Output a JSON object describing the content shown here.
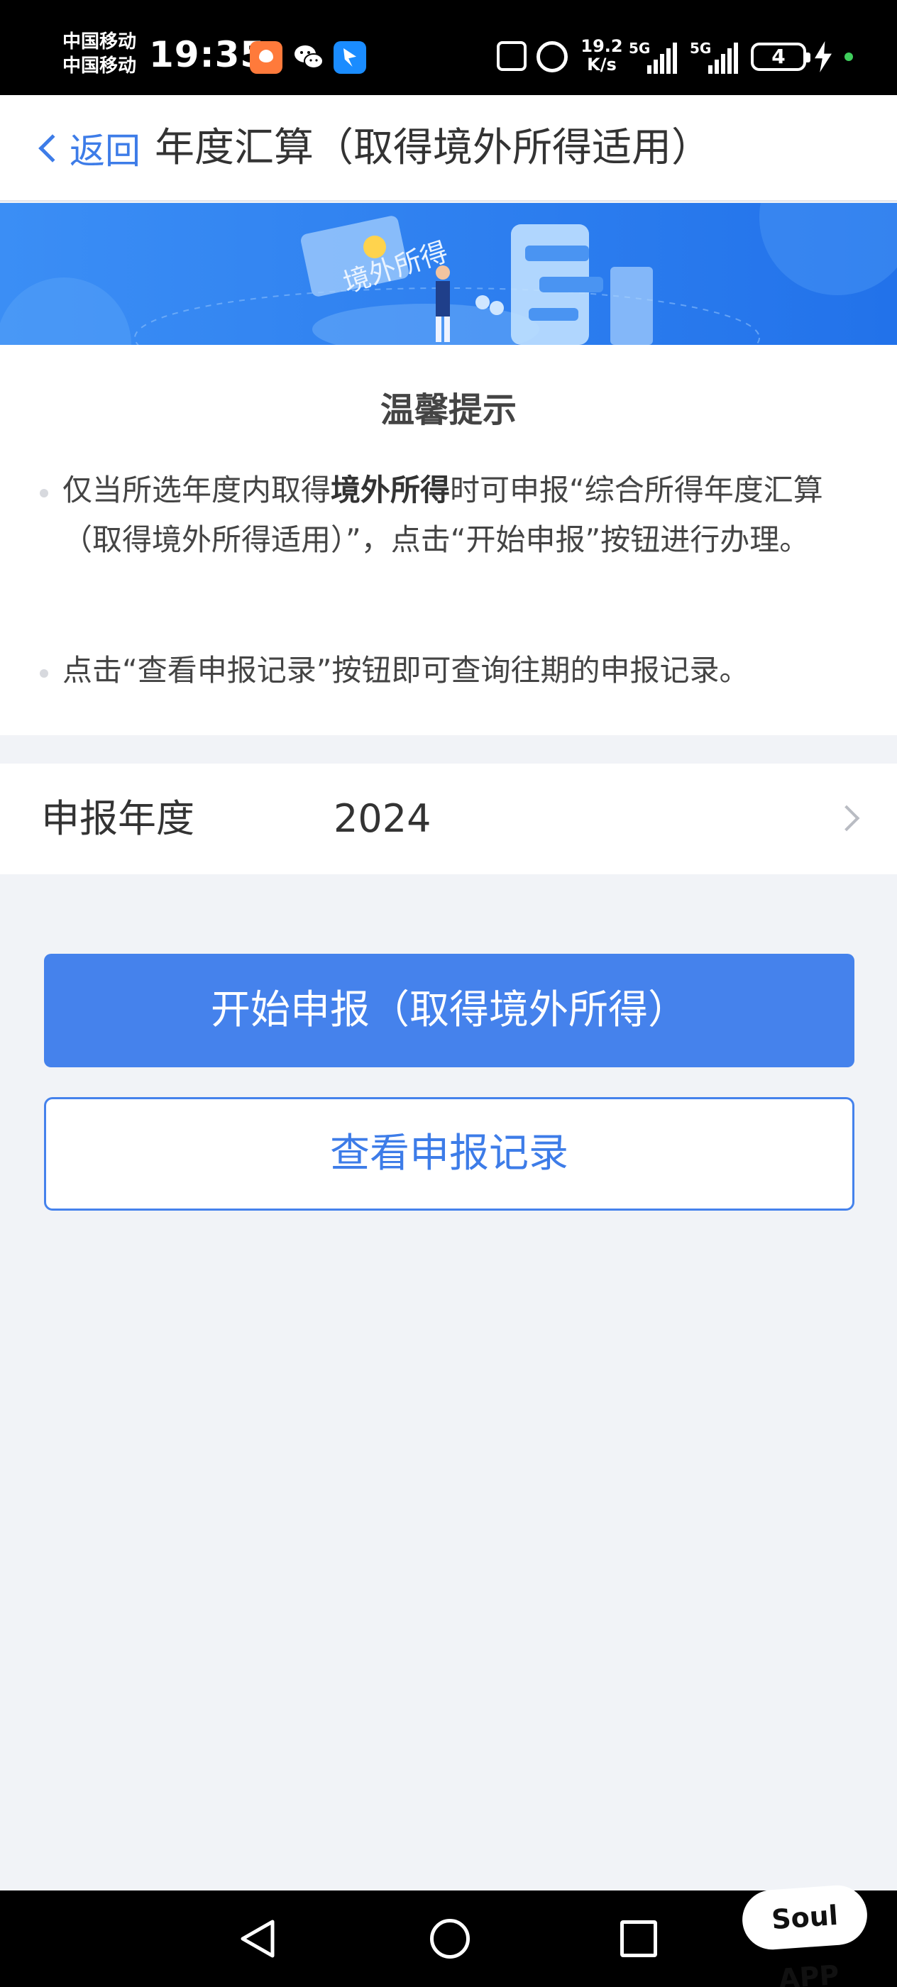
{
  "status_bar": {
    "carrier_1": "中国移动",
    "carrier_2": "中国移动",
    "time": "19:35",
    "net_speed_value": "19.2",
    "net_speed_unit": "K/s",
    "signal_1": "5G",
    "signal_2": "5G",
    "battery": "4",
    "icons": [
      "taobao-icon",
      "wechat-icon",
      "dingtalk-icon",
      "nfc-icon",
      "alarm-icon",
      "signal-icon",
      "battery-icon",
      "charging-icon"
    ]
  },
  "nav": {
    "back_label": "返回",
    "title": "年度汇算（取得境外所得适用）"
  },
  "banner": {
    "text": "境外所得",
    "colors": {
      "start": "#3a8df5",
      "end": "#1f6fe8"
    }
  },
  "notice": {
    "title": "温馨提示",
    "item_1_pre": "仅当所选年度内取得",
    "item_1_bold": "境外所得",
    "item_1_post": "时可申报“综合所得年度汇算（取得境外所得适用）”，点击“开始申报”按钮进行办理。",
    "item_2": "点击“查看申报记录”按钮即可查询往期的申报记录。"
  },
  "year_row": {
    "label": "申报年度",
    "value": "2024"
  },
  "buttons": {
    "start": "开始申报（取得境外所得）",
    "records": "查看申报记录"
  },
  "watermark": "Soul APP",
  "colors": {
    "accent": "#4582ec",
    "link": "#3d7ce8",
    "page_bg": "#f1f3f7"
  }
}
